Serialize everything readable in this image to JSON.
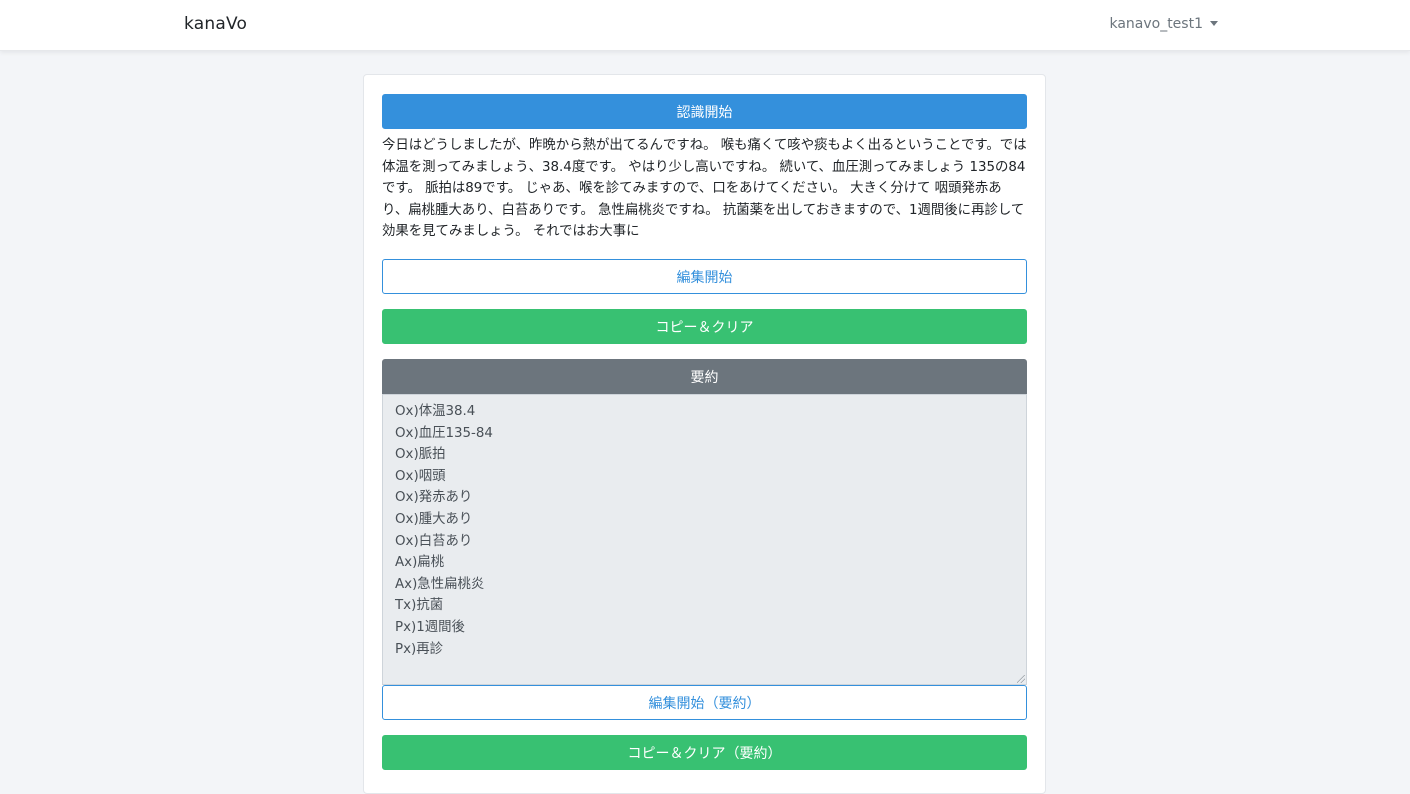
{
  "navbar": {
    "brand": "kanaVo",
    "user": "kanavo_test1"
  },
  "main": {
    "start_recognition_label": "認識開始",
    "transcript": "今日はどうしましたが、昨晩から熱が出てるんですね。 喉も痛くて咳や痰もよく出るということです。では体温を測ってみましょう、38.4度です。 やはり少し高いですね。 続いて、血圧測ってみましょう 135の84です。 脈拍は89です。 じゃあ、喉を診てみますので、口をあけてください。 大きく分けて 咽頭発赤あり、扁桃腫大あり、白苔ありです。 急性扁桃炎ですね。 抗菌薬を出しておきますので、1週間後に再診して効果を見てみましょう。 それではお大事に",
    "edit_start_label": "編集開始",
    "copy_clear_label": "コピー＆クリア",
    "summary_header_label": "要約",
    "summary_lines": [
      "Ox)体温38.4",
      "Ox)血圧135-84",
      "Ox)脈拍",
      "Ox)咽頭",
      "Ox)発赤あり",
      "Ox)腫大あり",
      "Ox)白苔あり",
      "Ax)扁桃",
      "Ax)急性扁桃炎",
      "Tx)抗菌",
      "Px)1週間後",
      "Px)再診"
    ],
    "edit_summary_label": "編集開始（要約）",
    "copy_clear_summary_label": "コピー＆クリア（要約）"
  },
  "colors": {
    "primary": "#3490dc",
    "success": "#38c172",
    "secondary": "#6c757d",
    "background": "#f3f5f8"
  }
}
